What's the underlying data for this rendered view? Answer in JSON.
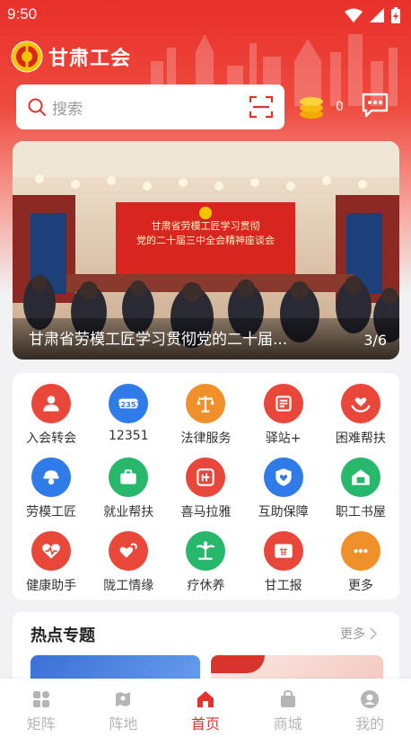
{
  "status_bar": {
    "time": "9:50"
  },
  "brand": {
    "name": "甘肃工会"
  },
  "search": {
    "placeholder": "搜索"
  },
  "header": {
    "coin_count": "0"
  },
  "banner": {
    "title": "甘肃省劳模工匠学习贯彻党的二十届...",
    "index": "3/6",
    "backdrop_line1": "甘肃省劳模工匠学习贯彻",
    "backdrop_line2": "党的二十届三中全会精神座谈会"
  },
  "services": [
    {
      "label": "入会转会",
      "icon": "user-badge-icon",
      "color": "#e9473a"
    },
    {
      "label": "12351",
      "icon": "hotline-12351-icon",
      "color": "#2f7be8"
    },
    {
      "label": "法律服务",
      "icon": "legal-scale-icon",
      "color": "#f0902a"
    },
    {
      "label": "驿站+",
      "icon": "post-station-icon",
      "color": "#e9473a"
    },
    {
      "label": "困难帮扶",
      "icon": "helping-heart-icon",
      "color": "#e9473a"
    },
    {
      "label": "劳模工匠",
      "icon": "worker-helmet-icon",
      "color": "#2f7be8"
    },
    {
      "label": "就业帮扶",
      "icon": "briefcase-icon",
      "color": "#28b86b"
    },
    {
      "label": "喜马拉雅",
      "icon": "audio-listen-icon",
      "color": "#e9473a"
    },
    {
      "label": "互助保障",
      "icon": "shield-heart-icon",
      "color": "#2f7be8"
    },
    {
      "label": "职工书屋",
      "icon": "book-house-icon",
      "color": "#28b86b"
    },
    {
      "label": "健康助手",
      "icon": "health-heart-icon",
      "color": "#e9473a"
    },
    {
      "label": "陇工情缘",
      "icon": "double-heart-icon",
      "color": "#e9473a"
    },
    {
      "label": "疗休养",
      "icon": "palm-tree-icon",
      "color": "#28b86b"
    },
    {
      "label": "甘工报",
      "icon": "newspaper-icon",
      "color": "#e9473a"
    },
    {
      "label": "更多",
      "icon": "more-dots-icon",
      "color": "#f0902a"
    }
  ],
  "hot_topics": {
    "title": "热点专题",
    "more": "更多"
  },
  "tabs": [
    {
      "label": "矩阵",
      "icon": "grid-icon",
      "active": false
    },
    {
      "label": "阵地",
      "icon": "map-pin-icon",
      "active": false
    },
    {
      "label": "首页",
      "icon": "home-icon",
      "active": true
    },
    {
      "label": "商城",
      "icon": "shopping-bag-icon",
      "active": false
    },
    {
      "label": "我的",
      "icon": "profile-icon",
      "active": false
    }
  ],
  "colors": {
    "brand_red": "#e5322d",
    "inactive_gray": "#b5b5b5"
  }
}
